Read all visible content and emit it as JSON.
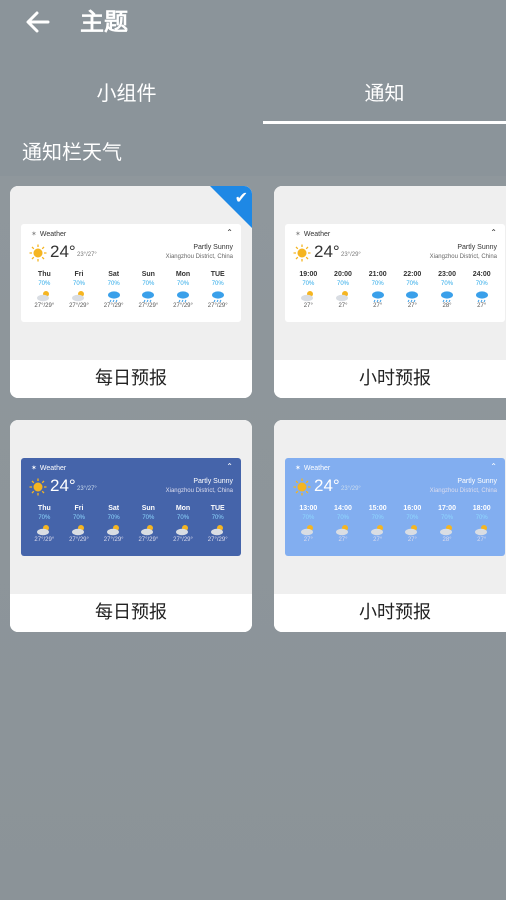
{
  "header": {
    "title": "主题"
  },
  "tabs": [
    {
      "label": "小组件"
    },
    {
      "label": "通知"
    }
  ],
  "section": {
    "title": "通知栏天气"
  },
  "colors": {
    "accent": "#1e88e5",
    "precip": "#2aa8e8"
  },
  "cards": [
    {
      "label": "每日预报",
      "selected": true,
      "widget": {
        "app": "Weather",
        "temp": "24°",
        "range": "23°/27°",
        "condition": "Partly Sunny",
        "location": "Xiangzhou District, China",
        "items": [
          {
            "n": "Thu",
            "p": "70%",
            "t": "27°/29°",
            "icon": "partly-sunny-icon"
          },
          {
            "n": "Fri",
            "p": "70%",
            "t": "27°/29°",
            "icon": "partly-sunny-icon"
          },
          {
            "n": "Sat",
            "p": "70%",
            "t": "27°/29°",
            "icon": "rain-icon"
          },
          {
            "n": "Sun",
            "p": "70%",
            "t": "27°/29°",
            "icon": "rain-icon"
          },
          {
            "n": "Mon",
            "p": "70%",
            "t": "27°/29°",
            "icon": "rain-icon"
          },
          {
            "n": "TUE",
            "p": "70%",
            "t": "27°/29°",
            "icon": "rain-icon"
          }
        ]
      }
    },
    {
      "label": "小时预报",
      "selected": false,
      "widget": {
        "app": "Weather",
        "temp": "24°",
        "range": "23°/29°",
        "condition": "Partly Sunny",
        "location": "Xiangzhou District, China",
        "items": [
          {
            "n": "19:00",
            "p": "70%",
            "t": "27°",
            "icon": "partly-sunny-icon"
          },
          {
            "n": "20:00",
            "p": "70%",
            "t": "27°",
            "icon": "partly-sunny-icon"
          },
          {
            "n": "21:00",
            "p": "70%",
            "t": "27°",
            "icon": "rain-icon"
          },
          {
            "n": "22:00",
            "p": "70%",
            "t": "27°",
            "icon": "rain-icon"
          },
          {
            "n": "23:00",
            "p": "70%",
            "t": "28°",
            "icon": "rain-icon"
          },
          {
            "n": "24:00",
            "p": "70%",
            "t": "27°",
            "icon": "rain-icon"
          }
        ]
      }
    },
    {
      "label": "每日预报",
      "selected": false,
      "widget": {
        "app": "Weather",
        "temp": "24°",
        "range": "23°/27°",
        "condition": "Partly Sunny",
        "location": "Xiangzhou District, China",
        "items": [
          {
            "n": "Thu",
            "p": "70%",
            "t": "27°/29°",
            "icon": "partly-sunny-icon"
          },
          {
            "n": "Fri",
            "p": "70%",
            "t": "27°/29°",
            "icon": "partly-sunny-icon"
          },
          {
            "n": "Sat",
            "p": "70%",
            "t": "27°/29°",
            "icon": "partly-sunny-icon"
          },
          {
            "n": "Sun",
            "p": "70%",
            "t": "27°/29°",
            "icon": "partly-sunny-icon"
          },
          {
            "n": "Mon",
            "p": "70%",
            "t": "27°/29°",
            "icon": "partly-sunny-icon"
          },
          {
            "n": "TUE",
            "p": "70%",
            "t": "27°/29°",
            "icon": "partly-sunny-icon"
          }
        ]
      }
    },
    {
      "label": "小时预报",
      "selected": false,
      "widget": {
        "app": "Weather",
        "temp": "24°",
        "range": "23°/29°",
        "condition": "Partly Sunny",
        "location": "Xiangzhou District, China",
        "items": [
          {
            "n": "13:00",
            "p": "70%",
            "t": "27°",
            "icon": "partly-sunny-icon"
          },
          {
            "n": "14:00",
            "p": "70%",
            "t": "27°",
            "icon": "partly-sunny-icon"
          },
          {
            "n": "15:00",
            "p": "70%",
            "t": "27°",
            "icon": "partly-sunny-icon"
          },
          {
            "n": "16:00",
            "p": "70%",
            "t": "27°",
            "icon": "partly-sunny-icon"
          },
          {
            "n": "17:00",
            "p": "70%",
            "t": "28°",
            "icon": "partly-sunny-icon"
          },
          {
            "n": "18:00",
            "p": "70%",
            "t": "27°",
            "icon": "partly-sunny-icon"
          }
        ]
      }
    }
  ]
}
